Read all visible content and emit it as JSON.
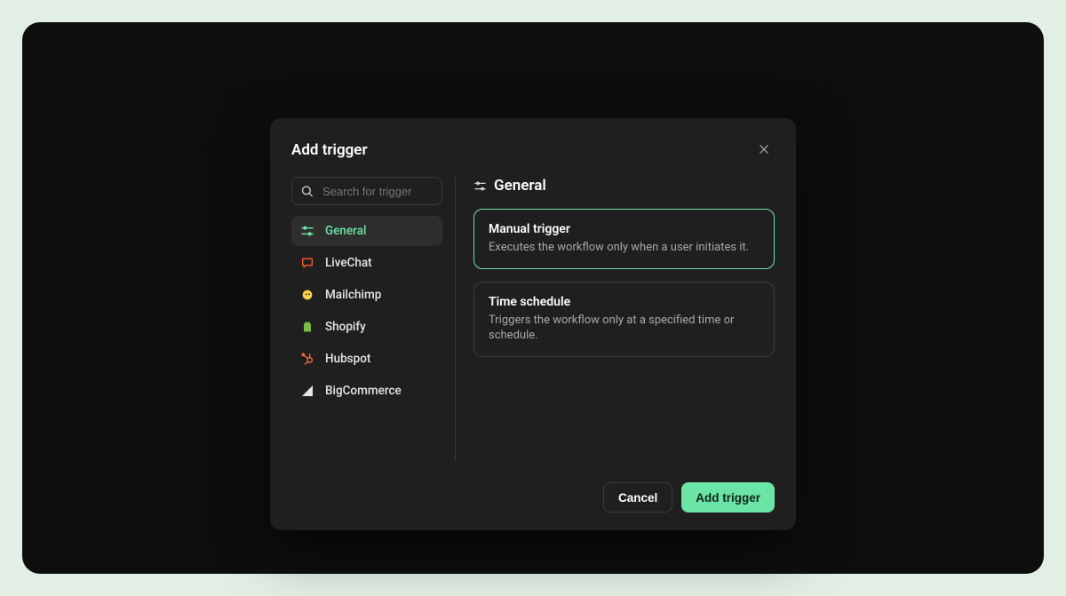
{
  "modal": {
    "title": "Add trigger",
    "search_placeholder": "Search for trigger",
    "categories": [
      {
        "label": "General",
        "icon": "general",
        "active": true
      },
      {
        "label": "LiveChat",
        "icon": "livechat",
        "active": false
      },
      {
        "label": "Mailchimp",
        "icon": "mailchimp",
        "active": false
      },
      {
        "label": "Shopify",
        "icon": "shopify",
        "active": false
      },
      {
        "label": "Hubspot",
        "icon": "hubspot",
        "active": false
      },
      {
        "label": "BigCommerce",
        "icon": "bigcommerce",
        "active": false
      }
    ],
    "panel_title": "General",
    "triggers": [
      {
        "title": "Manual trigger",
        "desc": "Executes the workflow only when a user initiates it.",
        "selected": true
      },
      {
        "title": "Time schedule",
        "desc": "Triggers the workflow only at a specified time or schedule.",
        "selected": false
      }
    ],
    "cancel_label": "Cancel",
    "submit_label": "Add trigger"
  },
  "colors": {
    "accent": "#6be5a5",
    "livechat": "#ff5b2e",
    "mailchimp": "#ffd24a",
    "shopify": "#7bbf4a",
    "hubspot": "#ff6a3a",
    "bigcommerce": "#e6e6e6"
  }
}
